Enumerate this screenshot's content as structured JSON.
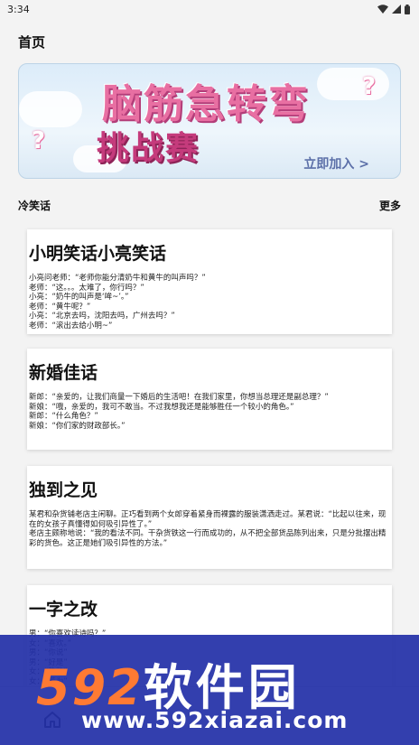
{
  "status_bar": {
    "time": "3:34"
  },
  "header": {
    "title": "首页"
  },
  "banner": {
    "title_line1": "脑筋急转弯",
    "title_line2": "挑战赛",
    "cta": "立即加入 >"
  },
  "section": {
    "title": "冷笑话",
    "more": "更多"
  },
  "cards": [
    {
      "title": "小明笑话小亮笑话",
      "body": "小亮问老师：“老师你能分清奶牛和黄牛的叫声吗？”\n老师：“这。。。太难了，你行吗？”\n小亮：“奶牛的叫声是‘哞~’。”\n老师：“黄牛呢？”\n小亮：“北京去吗，沈阳去吗，广州去吗？”\n老师：“滚出去给小明~”"
    },
    {
      "title": "新婚佳话",
      "body": "新郎：“亲爱的，让我们商量一下婚后的生活吧！在我们家里，你想当总理还是副总理？”\n新娘：“哦，亲爱的，我可不敢当。不过我想我还是能够胜任一个较小的角色。”\n新郎：“什么角色？”\n新娘：“你们家的财政部长。”"
    },
    {
      "title": "独到之见",
      "body": "某君和杂货铺老店主闲聊。正巧看到两个女郎穿着紧身而裸露的服装潇洒走过。某君说：“比起以往来，现在的女孩子真懂得如何吸引异性了。”\n老店主颇称地说：“我的看法不同。干杂货铁这一行而成功的，从不把全部货品陈列出来，只是分批摆出精彩的货色。这正是她们吸引异性的方法。”"
    },
    {
      "title": "一字之改",
      "body": "男：“你喜欢读诗吗？”\n女：“喜欢。”\n男：“你说”\n男：“好是”\n女：“改动”\n女：“若为”\n男：“哪”"
    }
  ],
  "watermark": {
    "logo_num": "592",
    "logo_cn": "软件园",
    "url": "www.592xiazai.com"
  }
}
